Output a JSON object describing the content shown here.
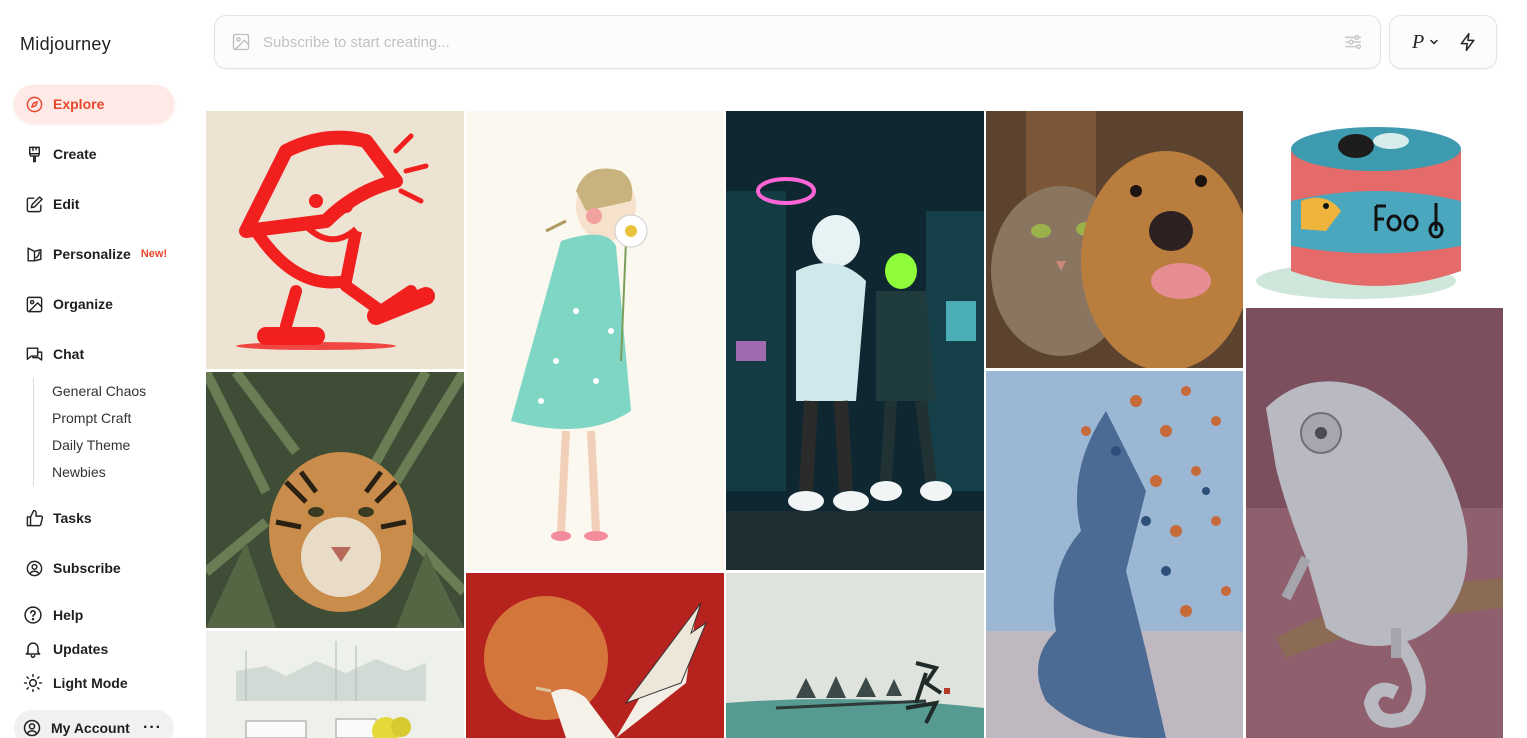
{
  "app": {
    "title": "Midjourney"
  },
  "nav": {
    "explore": "Explore",
    "create": "Create",
    "edit": "Edit",
    "personalize": "Personalize",
    "personalize_badge": "New!",
    "organize": "Organize",
    "chat": "Chat",
    "chat_channels": [
      "General Chaos",
      "Prompt Craft",
      "Daily Theme",
      "Newbies"
    ],
    "tasks": "Tasks",
    "subscribe": "Subscribe",
    "help": "Help",
    "updates": "Updates",
    "light_mode": "Light Mode",
    "my_account": "My Account",
    "account_more": "···"
  },
  "prompt": {
    "placeholder": "Subscribe to start creating..."
  },
  "mode": {
    "label": "P"
  },
  "colors": {
    "accent": "#e8472b",
    "accent_bg": "#fde9e6"
  },
  "gallery": {
    "images": [
      {
        "name": "pizza-slice-character"
      },
      {
        "name": "girl-with-daisy"
      },
      {
        "name": "neon-city-friends"
      },
      {
        "name": "cat-and-dog-selfie"
      },
      {
        "name": "dog-food-can"
      },
      {
        "name": "tiger-in-bamboo"
      },
      {
        "name": "butterfly-face"
      },
      {
        "name": "mirror-chameleon"
      },
      {
        "name": "misty-landscape"
      },
      {
        "name": "crane-and-sun"
      },
      {
        "name": "boatmen-ink-painting"
      }
    ]
  }
}
